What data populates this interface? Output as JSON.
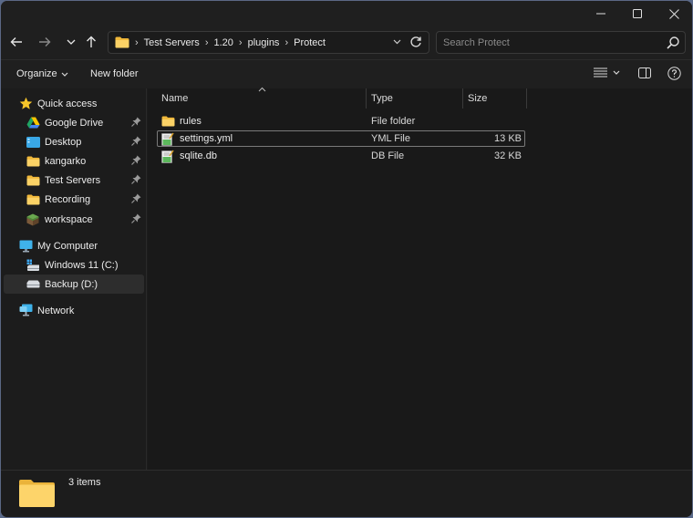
{
  "window": {
    "controls": {
      "minimize": "minimize",
      "maximize": "maximize",
      "close": "close"
    }
  },
  "address_bar": {
    "breadcrumbs": [
      "Test Servers",
      "1.20",
      "plugins",
      "Protect"
    ],
    "separator": "›"
  },
  "search": {
    "placeholder": "Search Protect",
    "value": ""
  },
  "command_bar": {
    "organize_label": "Organize",
    "new_folder_label": "New folder"
  },
  "sidebar": {
    "quick_access": {
      "label": "Quick access",
      "items": [
        {
          "label": "Google Drive",
          "icon": "google-drive-icon",
          "pinned": true
        },
        {
          "label": "Desktop",
          "icon": "desktop-icon",
          "pinned": true
        },
        {
          "label": "kangarko",
          "icon": "folder-icon",
          "pinned": true
        },
        {
          "label": "Test Servers",
          "icon": "folder-icon",
          "pinned": true
        },
        {
          "label": "Recording",
          "icon": "folder-icon",
          "pinned": true
        },
        {
          "label": "workspace",
          "icon": "minecraft-block-icon",
          "pinned": true
        }
      ]
    },
    "my_computer": {
      "label": "My Computer",
      "items": [
        {
          "label": "Windows 11 (C:)",
          "icon": "system-drive-icon"
        },
        {
          "label": "Backup (D:)",
          "icon": "drive-icon",
          "selected": true
        }
      ]
    },
    "network": {
      "label": "Network"
    }
  },
  "file_list": {
    "columns": {
      "name": "Name",
      "type": "Type",
      "size": "Size"
    },
    "sort": {
      "column": "Name",
      "direction": "ascending"
    },
    "rows": [
      {
        "name": "rules",
        "type": "File folder",
        "size": "",
        "icon": "folder-icon"
      },
      {
        "name": "settings.yml",
        "type": "YML File",
        "size": "13 KB",
        "icon": "text-file-icon",
        "focused": true
      },
      {
        "name": "sqlite.db",
        "type": "DB File",
        "size": "32 KB",
        "icon": "text-file-icon"
      }
    ]
  },
  "status_bar": {
    "item_count": "3 items"
  },
  "colors": {
    "background": "#1c1c1c",
    "folder": "#f8cf5a",
    "border_accent": "#5b6784",
    "selection": "#2d2d2d"
  }
}
